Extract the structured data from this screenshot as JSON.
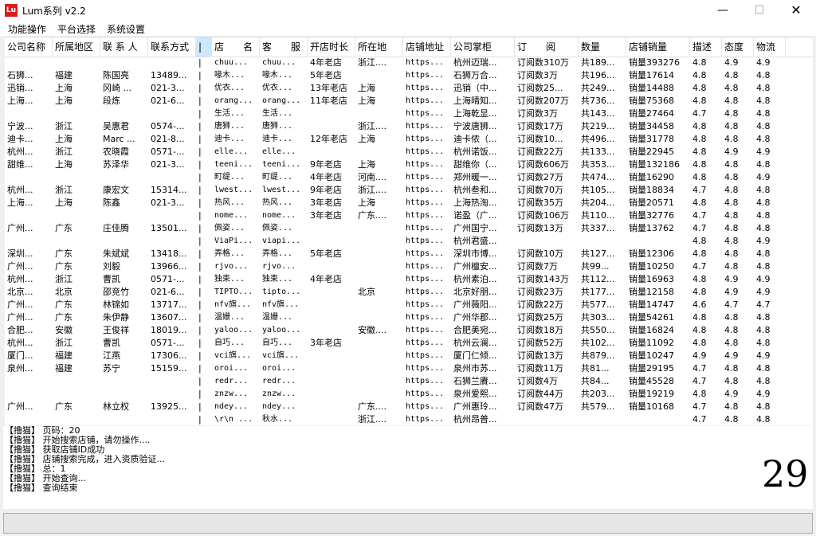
{
  "window": {
    "icon_text": "Lu",
    "title": "Lum系列 v2.2",
    "minimize": "—",
    "maximize": "☐",
    "close": "✕"
  },
  "menu": [
    "功能操作",
    "平台选择",
    "系统设置"
  ],
  "columns": [
    "公司名称",
    "所属地区",
    "联 系 人",
    "联系方式",
    "|",
    "店　　名",
    "客　　服",
    "开店时长",
    "所在地",
    "店铺地址",
    "公司掌柜",
    "订　　阅",
    "数量",
    "店铺销量",
    "描述",
    "态度",
    "物流"
  ],
  "rows": [
    [
      "",
      "",
      "",
      "",
      "|",
      "chuu...",
      "chuu...",
      "4年老店",
      "浙江....",
      "https...",
      "杭州迈瑞...",
      "订阅数310万",
      "共189...",
      "销量393276",
      "4.8",
      "4.9",
      "4.9"
    ],
    [
      "石狮...",
      "福建",
      "陈国亮",
      "13489...",
      "|",
      "喙木...",
      "喙木...",
      "5年老店",
      "",
      "https...",
      "石狮万合...",
      "订阅数3万",
      "共196...",
      "销量17614",
      "4.8",
      "4.8",
      "4.8"
    ],
    [
      "迅销...",
      "上海",
      "冈崎 ...",
      "021-3...",
      "|",
      "优衣...",
      "优衣...",
      "13年老店",
      "上海",
      "https...",
      "迅销（中...",
      "订阅数25...",
      "共249...",
      "销量14488",
      "4.8",
      "4.8",
      "4.8"
    ],
    [
      "上海...",
      "上海",
      "段炼",
      "021-6...",
      "|",
      "orang...",
      "orang...",
      "11年老店",
      "上海",
      "https...",
      "上海晴知...",
      "订阅数207万",
      "共736...",
      "销量75368",
      "4.8",
      "4.8",
      "4.8"
    ],
    [
      "",
      "",
      "",
      "",
      "|",
      "生活...",
      "生活...",
      "",
      "",
      "https...",
      "上海乾显...",
      "订阅数3万",
      "共143...",
      "销量27464",
      "4.7",
      "4.8",
      "4.8"
    ],
    [
      "宁波...",
      "浙江",
      "吴惠君",
      "0574-...",
      "|",
      "唐狮...",
      "唐狮...",
      "",
      "浙江....",
      "https...",
      "宁波唐狮...",
      "订阅数17万",
      "共219...",
      "销量34458",
      "4.8",
      "4.8",
      "4.8"
    ],
    [
      "迪卡...",
      "上海",
      "Marc ...",
      "021-8...",
      "|",
      "迪卡...",
      "迪卡...",
      "12年老店",
      "上海",
      "https...",
      "迪卡侬（...",
      "订阅数10...",
      "共496...",
      "销量31778",
      "4.8",
      "4.8",
      "4.8"
    ],
    [
      "杭州...",
      "浙江",
      "农晓霞",
      "0571-...",
      "|",
      "elle...",
      "elle...",
      "",
      "",
      "https...",
      "杭州诺饭...",
      "订阅数22万",
      "共133...",
      "销量22945",
      "4.8",
      "4.9",
      "4.9"
    ],
    [
      "甜维...",
      "上海",
      "苏泽华",
      "021-3...",
      "|",
      "teeni...",
      "teeni...",
      "9年老店",
      "上海",
      "https...",
      "甜维你（...",
      "订阅数606万",
      "共353...",
      "销量132186",
      "4.8",
      "4.8",
      "4.8"
    ],
    [
      "",
      "",
      "",
      "",
      "|",
      "町缇...",
      "町缇...",
      "4年老店",
      "河南....",
      "https...",
      "郑州暖一...",
      "订阅数27万",
      "共474...",
      "销量16290",
      "4.8",
      "4.8",
      "4.9"
    ],
    [
      "杭州...",
      "浙江",
      "康宏文",
      "15314...",
      "|",
      "lwest...",
      "lwest...",
      "9年老店",
      "浙江....",
      "https...",
      "杭州叁和...",
      "订阅数70万",
      "共105...",
      "销量18834",
      "4.7",
      "4.8",
      "4.8"
    ],
    [
      "上海...",
      "上海",
      "陈鑫",
      "021-3...",
      "|",
      "热风...",
      "热风...",
      "3年老店",
      "上海",
      "https...",
      "上海热淘...",
      "订阅数35万",
      "共204...",
      "销量20571",
      "4.8",
      "4.8",
      "4.8"
    ],
    [
      "",
      "",
      "",
      "",
      "|",
      "nome...",
      "nome...",
      "3年老店",
      "广东....",
      "https...",
      "诺盈（广...",
      "订阅数106万",
      "共110...",
      "销量32776",
      "4.7",
      "4.8",
      "4.8"
    ],
    [
      "广州...",
      "广东",
      "庄佳腾",
      "13501...",
      "|",
      "佩姿...",
      "佩姿...",
      "",
      "",
      "https...",
      "广州国宁...",
      "订阅数13万",
      "共337...",
      "销量13762",
      "4.7",
      "4.8",
      "4.8"
    ],
    [
      "",
      "",
      "",
      "",
      "|",
      "ViaPi...",
      "viapi...",
      "",
      "",
      "https...",
      "杭州君盛...",
      "",
      "",
      "",
      "4.8",
      "4.8",
      "4.9"
    ],
    [
      "深圳...",
      "广东",
      "朱斌斌",
      "13418...",
      "|",
      "弄格...",
      "弄格...",
      "5年老店",
      "",
      "https...",
      "深圳市博...",
      "订阅数10万",
      "共127...",
      "销量12306",
      "4.8",
      "4.8",
      "4.8"
    ],
    [
      "广州...",
      "广东",
      "刘毅",
      "13966...",
      "|",
      "rjvo...",
      "rjvo...",
      "",
      "",
      "https...",
      "广州檀安...",
      "订阅数7万",
      "共99...",
      "销量10250",
      "4.7",
      "4.8",
      "4.8"
    ],
    [
      "杭州...",
      "浙江",
      "曹凯",
      "0571-...",
      "|",
      "独束...",
      "独束...",
      "4年老店",
      "",
      "https...",
      "杭州素泊...",
      "订阅数143万",
      "共112...",
      "销量16963",
      "4.8",
      "4.9",
      "4.9"
    ],
    [
      "北京...",
      "北京",
      "邵竞竹",
      "021-6...",
      "|",
      "TIPTO...",
      "tipto...",
      "",
      "北京",
      "https...",
      "北京好朋...",
      "订阅数23万",
      "共177...",
      "销量12158",
      "4.8",
      "4.9",
      "4.9"
    ],
    [
      "广州...",
      "广东",
      "林锦如",
      "13717...",
      "|",
      "nfv旗...",
      "nfv旗...",
      "",
      "",
      "https...",
      "广州薇阳...",
      "订阅数22万",
      "共577...",
      "销量14747",
      "4.6",
      "4.7",
      "4.7"
    ],
    [
      "广州...",
      "广东",
      "朱伊静",
      "13607...",
      "|",
      "温姗...",
      "温姗...",
      "",
      "",
      "https...",
      "广州华郡...",
      "订阅数25万",
      "共303...",
      "销量54261",
      "4.8",
      "4.8",
      "4.8"
    ],
    [
      "合肥...",
      "安徽",
      "王俊祥",
      "18019...",
      "|",
      "yaloo...",
      "yaloo...",
      "",
      "安徽....",
      "https...",
      "合肥美宛...",
      "订阅数18万",
      "共550...",
      "销量16824",
      "4.8",
      "4.8",
      "4.8"
    ],
    [
      "杭州...",
      "浙江",
      "曹凯",
      "0571-...",
      "|",
      "自巧...",
      "自巧...",
      "3年老店",
      "",
      "https...",
      "杭州云澜...",
      "订阅数52万",
      "共102...",
      "销量11092",
      "4.8",
      "4.8",
      "4.8"
    ],
    [
      "厦门...",
      "福建",
      "江燕",
      "17306...",
      "|",
      "vci旗...",
      "vci旗...",
      "",
      "",
      "https...",
      "厦门仁倾...",
      "订阅数13万",
      "共879...",
      "销量10247",
      "4.9",
      "4.9",
      "4.9"
    ],
    [
      "泉州...",
      "福建",
      "苏宁",
      "15159...",
      "|",
      "oroi...",
      "oroi...",
      "",
      "",
      "https...",
      "泉州市苏...",
      "订阅数11万",
      "共81...",
      "销量29195",
      "4.7",
      "4.8",
      "4.8"
    ],
    [
      "",
      "",
      "",
      "",
      "|",
      "redr...",
      "redr...",
      "",
      "",
      "https...",
      "石狮兰賡...",
      "订阅数4万",
      "共84...",
      "销量45528",
      "4.7",
      "4.8",
      "4.8"
    ],
    [
      "",
      "",
      "",
      "",
      "|",
      "znzw...",
      "znzw...",
      "",
      "",
      "https...",
      "泉州爱熙...",
      "订阅数44万",
      "共203...",
      "销量19219",
      "4.8",
      "4.9",
      "4.9"
    ],
    [
      "广州...",
      "广东",
      "林立权",
      "13925...",
      "|",
      "ndey...",
      "ndey...",
      "",
      "广东....",
      "https...",
      "广州惠玲...",
      "订阅数47万",
      "共579...",
      "销量10168",
      "4.7",
      "4.8",
      "4.8"
    ],
    [
      "",
      "",
      "",
      "",
      "|",
      "\\r\\n ...",
      "秋水...",
      "",
      "浙江....",
      "https...",
      "杭州昂普...",
      "",
      "",
      "",
      "4.7",
      "4.8",
      "4.8"
    ]
  ],
  "log": [
    "【撸猫】 页码：20",
    "【撸猫】 开始搜索店铺，请勿操作....",
    "【撸猫】 获取店铺ID成功",
    "【撸猫】 店铺搜索完成，进入资质验证...",
    "【撸猫】 总：1",
    "【撸猫】 开始查询...",
    "【撸猫】 查询结束"
  ],
  "counter": "29",
  "colors": {
    "selected_header": "#cce8ff",
    "app_icon": "#d42020"
  }
}
